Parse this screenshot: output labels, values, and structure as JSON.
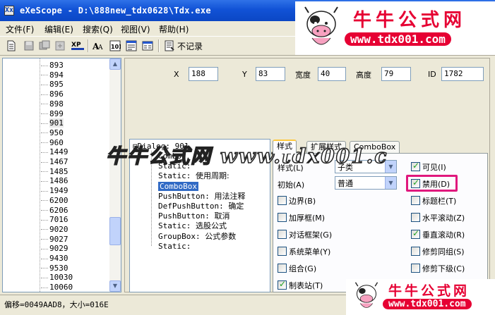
{
  "window": {
    "title": "eXeScope - D:\\888new_tdx0628\\Tdx.exe",
    "app_icon_text": "Xx"
  },
  "menu": [
    {
      "label": "文件(F)"
    },
    {
      "label": "编辑(E)"
    },
    {
      "label": "搜索(Q)"
    },
    {
      "label": "视图(V)"
    },
    {
      "label": "帮助(H)"
    }
  ],
  "toolbar": {
    "nolog_label": "不记录",
    "icons": [
      "page-icon",
      "save-icon",
      "save-all-icon",
      "export-icon",
      "xp-icon",
      "font-icon",
      "data-icon",
      "dialog-icon",
      "menu-icon",
      "nolog-icon"
    ]
  },
  "tree": {
    "items": [
      "893",
      "894",
      "895",
      "896",
      "898",
      "899",
      "901",
      "950",
      "960",
      "1449",
      "1467",
      "1485",
      "1486",
      "1949",
      "6200",
      "6206",
      "7016",
      "9020",
      "9027",
      "9029",
      "9430",
      "9530",
      "10030",
      "10060"
    ],
    "selected": "901"
  },
  "props": {
    "x_label": "X",
    "x_value": "188",
    "y_label": "Y",
    "y_value": "83",
    "width_label": "宽度",
    "width_value": "40",
    "height_label": "高度",
    "height_value": "79",
    "id_label": "ID",
    "id_value": "1782"
  },
  "dialog_tree": {
    "root": "Dialog: 901",
    "items": [
      {
        "type": "Combo",
        "text": ""
      },
      {
        "type": "Static:",
        "text": ""
      },
      {
        "type": "Static:",
        "text": "使用周期:"
      },
      {
        "type": "ComboBox",
        "text": ""
      },
      {
        "type": "PushButton:",
        "text": "用法注释"
      },
      {
        "type": "DefPushButton:",
        "text": "确定"
      },
      {
        "type": "PushButton:",
        "text": "取消"
      },
      {
        "type": "Static:",
        "text": "选股公式"
      },
      {
        "type": "GroupBox:",
        "text": "公式参数"
      },
      {
        "type": "Static:",
        "text": ""
      }
    ],
    "selected_index": 3
  },
  "tabs": [
    {
      "label": "样式"
    },
    {
      "label": "扩展样式"
    },
    {
      "label": "ComboBox"
    }
  ],
  "style_tab": {
    "style_label": "样式(L)",
    "style_value": "子类",
    "init_label": "初始(A)",
    "init_value": "普通",
    "left_checks": [
      {
        "label": "边界(B)",
        "checked": false
      },
      {
        "label": "加厚框(M)",
        "checked": false
      },
      {
        "label": "对话框架(G)",
        "checked": false
      },
      {
        "label": "系统菜单(Y)",
        "checked": false
      },
      {
        "label": "组合(G)",
        "checked": false
      },
      {
        "label": "制表站(T)",
        "checked": true
      }
    ],
    "right_checks": [
      {
        "label": "可见(I)",
        "checked": true
      },
      {
        "label": "禁用(D)",
        "checked": true
      },
      {
        "label": "标题栏(T)",
        "checked": false
      },
      {
        "label": "水平滚动(Z)",
        "checked": false
      },
      {
        "label": "垂直滚动(R)",
        "checked": true
      },
      {
        "label": "修剪同组(S)",
        "checked": false
      },
      {
        "label": "修剪下级(C)",
        "checked": false
      }
    ]
  },
  "status": {
    "text": "偏移=0049AAD8，大小=016E"
  },
  "watermark": {
    "brand_cn": "牛牛公式网",
    "brand_url": "www.tdx001.com",
    "overlay_text": "牛牛公式网 www.tdx001.c",
    "colors": {
      "brand": "#e60033"
    }
  }
}
